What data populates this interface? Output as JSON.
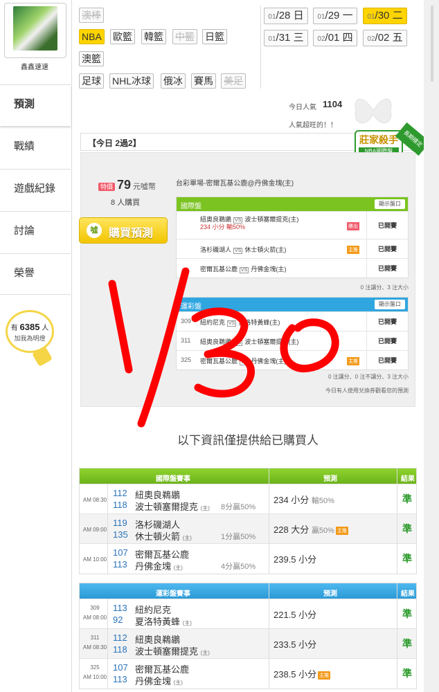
{
  "sidebar": {
    "username": "鑫鑫速速",
    "items": [
      "預測",
      "戰績",
      "遊戲紀錄",
      "討論",
      "榮譽"
    ],
    "fans": {
      "prefix": "有",
      "count": "6385",
      "suffix": "人",
      "note": "加我為明燈"
    }
  },
  "sports": {
    "row1": [
      "澳棒"
    ],
    "row2": [
      "NBA",
      "歐籃",
      "韓籃",
      "中籃",
      "日籃"
    ],
    "row3": [
      "澳籃"
    ],
    "row4": [
      "足球",
      "NHL冰球",
      "俄冰",
      "賽馬",
      "美足"
    ]
  },
  "dates": [
    {
      "md": "01",
      "d": "/28",
      "w": "日"
    },
    {
      "md": "01",
      "d": "/29",
      "w": "一"
    },
    {
      "md": "01",
      "d": "/30",
      "w": "二"
    },
    {
      "md": "01",
      "d": "/31",
      "w": "三"
    },
    {
      "md": "02",
      "d": "/01",
      "w": "四"
    },
    {
      "md": "02",
      "d": "/02",
      "w": "五"
    }
  ],
  "popularity": {
    "label": "今日人氣",
    "value": "1104",
    "note": "人氣超旺的！！"
  },
  "today_bar": "【今日 2過2】",
  "badge": {
    "title": "莊家殺手",
    "sub": "NBA國際盤",
    "ribbon": "長期穩定"
  },
  "package": {
    "price_tag": "特價",
    "price": "79",
    "price_unit": "元噓幣",
    "buyers": "8 人購買",
    "buy_button": "購買預測",
    "buy_icon": "噓",
    "title": "台彩單場-密爾瓦基公鹿@丹佛金塊(主)",
    "intl": {
      "header": "國際盤",
      "show": "顯示盤口",
      "rows": [
        {
          "away": "紐奧良鵜鶘",
          "home": "波士頓塞爾提克(主)",
          "pick": "234 小分 輸50%",
          "tag": "勝出",
          "status": "已開賽"
        },
        {
          "away": "洛杉磯湖人",
          "home": "休士頓火箭(主)",
          "pick": "",
          "tag": "主推",
          "status": "已開賽"
        },
        {
          "away": "密爾瓦基公鹿",
          "home": "丹佛金塊(主)",
          "pick": "",
          "tag": "",
          "status": "已開賽"
        }
      ],
      "foot": "0 注讓分、3 注大小"
    },
    "lottery": {
      "header": "運彩盤",
      "show": "顯示盤口",
      "rows": [
        {
          "no": "309",
          "away": "紐約尼克",
          "home": "夏洛特黃蜂(主)",
          "tag": "",
          "status": "已開賽"
        },
        {
          "no": "311",
          "away": "紐奧良鵜鶘",
          "home": "波士頓塞爾提克(主)",
          "tag": "",
          "status": "已開賽"
        },
        {
          "no": "325",
          "away": "密爾瓦基公鹿",
          "home": "丹佛金塊(主)",
          "tag": "主推",
          "status": "已開賽"
        }
      ],
      "foot": "0 注讓分、0 注不讓分、3 注大小"
    },
    "note": "今日有人使用兌換券觀看您的預測"
  },
  "info_title": "以下資訊僅提供給已購買人",
  "intl_table": {
    "headers": [
      "國際盤賽事",
      "預測",
      "結果"
    ],
    "rows": [
      {
        "time": "AM 08:30",
        "n1": "112",
        "t1": "紐奧良鵜鶘",
        "n2": "118",
        "t2": "波士頓塞爾提克",
        "home": "(主)",
        "rate": "8分贏50%",
        "pred": "234 小分",
        "sub": "輸50%",
        "tag": "",
        "res": "準"
      },
      {
        "time": "AM 09:00",
        "n1": "119",
        "t1": "洛杉磯湖人",
        "n2": "135",
        "t2": "休士頓火箭",
        "home": "(主)",
        "rate": "1分贏50%",
        "pred": "228 大分",
        "sub": "贏50%",
        "tag": "主推",
        "res": "準"
      },
      {
        "time": "AM 10:00",
        "n1": "107",
        "t1": "密爾瓦基公鹿",
        "n2": "113",
        "t2": "丹佛金塊",
        "home": "(主)",
        "rate": "4分贏50%",
        "pred": "239.5 小分",
        "sub": "",
        "tag": "",
        "res": "準"
      }
    ]
  },
  "lottery_table": {
    "headers": [
      "運彩盤賽事",
      "預測",
      "結果"
    ],
    "rows": [
      {
        "no": "309",
        "time": "AM 08:00",
        "n1": "113",
        "t1": "紐約尼克",
        "n2": "92",
        "t2": "夏洛特黃蜂",
        "home": "(主)",
        "pred": "221.5 小分",
        "tag": "",
        "res": "準"
      },
      {
        "no": "311",
        "time": "AM 08:30",
        "n1": "112",
        "t1": "紐奧良鵜鶘",
        "n2": "118",
        "t2": "波士頓塞爾提克",
        "home": "(主)",
        "pred": "233.5 小分",
        "tag": "",
        "res": "準"
      },
      {
        "no": "325",
        "time": "AM 10:00",
        "n1": "107",
        "t1": "密爾瓦基公鹿",
        "n2": "113",
        "t2": "丹佛金塊",
        "home": "(主)",
        "pred": "238.5 小分",
        "tag": "主推",
        "res": "準"
      }
    ]
  },
  "colors": {
    "accent": "#ffd400",
    "green": "#7bc320",
    "blue": "#2fa6e0",
    "ink": "#ff0000"
  }
}
